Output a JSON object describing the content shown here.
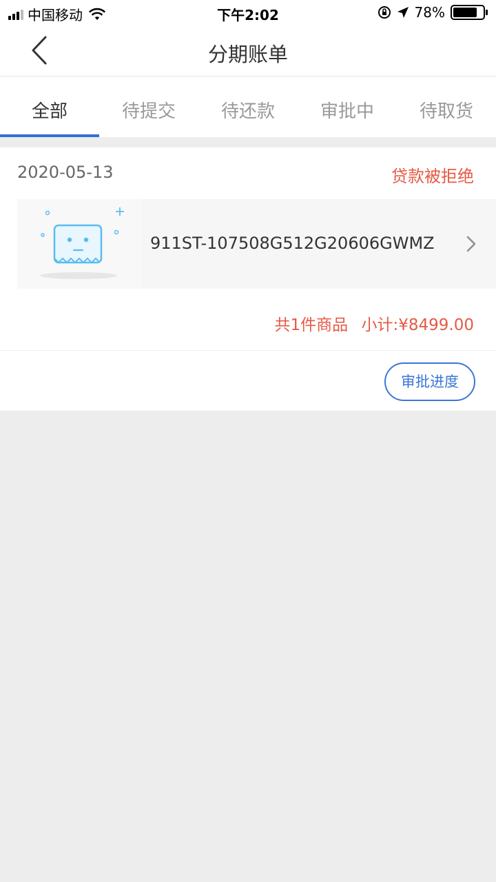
{
  "status_bar": {
    "carrier": "中国移动",
    "time": "下午2:02",
    "battery": "78%"
  },
  "nav": {
    "title": "分期账单"
  },
  "tabs": [
    {
      "label": "全部",
      "active": true
    },
    {
      "label": "待提交",
      "active": false
    },
    {
      "label": "待还款",
      "active": false
    },
    {
      "label": "审批中",
      "active": false
    },
    {
      "label": "待取货",
      "active": false
    }
  ],
  "order": {
    "date": "2020-05-13",
    "status": "贷款被拒绝",
    "item_name": "911ST-107508G512G20606GWMZ",
    "count_text": "共1件商品",
    "subtotal_text": "小计:¥8499.00",
    "action_label": "审批进度"
  },
  "colors": {
    "accent_blue": "#2f6fd8",
    "status_red": "#e65a45",
    "placeholder_blue": "#5bbbf0"
  },
  "icons": {
    "back": "chevron-left-icon",
    "item_arrow": "chevron-right-icon",
    "thumbnail": "placeholder-image-icon"
  }
}
